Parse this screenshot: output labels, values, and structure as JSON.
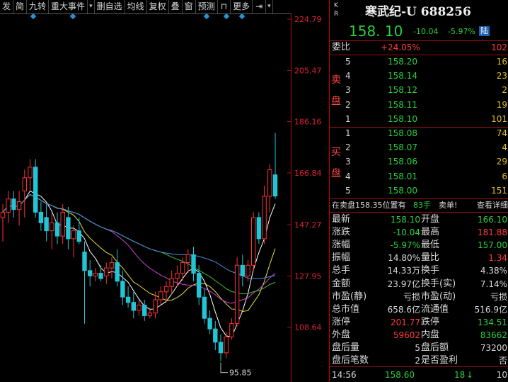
{
  "toolbar": {
    "items": [
      "发",
      "简",
      "九转",
      "重大事件",
      "▾",
      "删自选",
      "均线",
      "复权",
      "叠",
      "窗",
      "预测",
      "⊓",
      "更多",
      "⇥",
      "▾"
    ]
  },
  "chart": {
    "y_ticks": [
      "224.79",
      "205.47",
      "186.16",
      "166.84",
      "147.27",
      "127.95",
      "108.64"
    ],
    "low_label": "95.85",
    "colors": {
      "up": "#ff3333",
      "down": "#21c5d6",
      "ma5": "#ffffff",
      "ma10": "#e8e040",
      "ma20": "#d040d0",
      "ma60": "#40c040",
      "ma120": "#4a90e0"
    }
  },
  "chart_data": {
    "type": "candlestick",
    "ylim": [
      88,
      232
    ],
    "y_ticks": [
      224.79,
      205.47,
      186.16,
      166.84,
      147.27,
      127.95,
      108.64
    ],
    "low_annotation": 95.85,
    "candles": [
      {
        "o": 150,
        "h": 155,
        "l": 141,
        "c": 152
      },
      {
        "o": 152,
        "h": 160,
        "l": 148,
        "c": 157
      },
      {
        "o": 157,
        "h": 160,
        "l": 150,
        "c": 153
      },
      {
        "o": 153,
        "h": 160,
        "l": 147,
        "c": 156
      },
      {
        "o": 160,
        "h": 168,
        "l": 150,
        "c": 165
      },
      {
        "o": 165,
        "h": 172,
        "l": 160,
        "c": 169
      },
      {
        "o": 169,
        "h": 172,
        "l": 150,
        "c": 152
      },
      {
        "o": 152,
        "h": 156,
        "l": 145,
        "c": 148
      },
      {
        "o": 150,
        "h": 155,
        "l": 141,
        "c": 145
      },
      {
        "o": 145,
        "h": 152,
        "l": 138,
        "c": 148
      },
      {
        "o": 148,
        "h": 152,
        "l": 140,
        "c": 143
      },
      {
        "o": 143,
        "h": 155,
        "l": 140,
        "c": 152
      },
      {
        "o": 150,
        "h": 154,
        "l": 138,
        "c": 142
      },
      {
        "o": 142,
        "h": 147,
        "l": 135,
        "c": 145
      },
      {
        "o": 145,
        "h": 150,
        "l": 140,
        "c": 141
      },
      {
        "o": 137,
        "h": 141,
        "l": 110,
        "c": 130
      },
      {
        "o": 130,
        "h": 134,
        "l": 124,
        "c": 128
      },
      {
        "o": 128,
        "h": 131,
        "l": 126,
        "c": 129
      },
      {
        "o": 129,
        "h": 132,
        "l": 126,
        "c": 127
      },
      {
        "o": 128,
        "h": 133,
        "l": 125,
        "c": 131
      },
      {
        "o": 131,
        "h": 135,
        "l": 127,
        "c": 133
      },
      {
        "o": 133,
        "h": 138,
        "l": 124,
        "c": 126
      },
      {
        "o": 126,
        "h": 130,
        "l": 117,
        "c": 120
      },
      {
        "o": 120,
        "h": 124,
        "l": 116,
        "c": 118
      },
      {
        "o": 118,
        "h": 122,
        "l": 112,
        "c": 115
      },
      {
        "o": 115,
        "h": 119,
        "l": 113,
        "c": 117
      },
      {
        "o": 117,
        "h": 119,
        "l": 111,
        "c": 113
      },
      {
        "o": 113,
        "h": 116,
        "l": 112,
        "c": 114
      },
      {
        "o": 114,
        "h": 122,
        "l": 112,
        "c": 119
      },
      {
        "o": 119,
        "h": 124,
        "l": 117,
        "c": 122
      },
      {
        "o": 122,
        "h": 126,
        "l": 118,
        "c": 124
      },
      {
        "o": 124,
        "h": 130,
        "l": 121,
        "c": 127
      },
      {
        "o": 127,
        "h": 132,
        "l": 124,
        "c": 129
      },
      {
        "o": 129,
        "h": 135,
        "l": 126,
        "c": 133
      },
      {
        "o": 133,
        "h": 138,
        "l": 129,
        "c": 136
      },
      {
        "o": 136,
        "h": 139,
        "l": 126,
        "c": 129
      },
      {
        "o": 129,
        "h": 132,
        "l": 117,
        "c": 120
      },
      {
        "o": 120,
        "h": 123,
        "l": 110,
        "c": 112
      },
      {
        "o": 112,
        "h": 115,
        "l": 106,
        "c": 108
      },
      {
        "o": 108,
        "h": 111,
        "l": 100,
        "c": 103
      },
      {
        "o": 103,
        "h": 106,
        "l": 95.85,
        "c": 99
      },
      {
        "o": 99,
        "h": 107,
        "l": 97,
        "c": 105
      },
      {
        "o": 105,
        "h": 112,
        "l": 104,
        "c": 110
      },
      {
        "o": 110,
        "h": 135,
        "l": 109,
        "c": 132
      },
      {
        "o": 132,
        "h": 136,
        "l": 124,
        "c": 128
      },
      {
        "o": 128,
        "h": 134,
        "l": 126,
        "c": 132
      },
      {
        "o": 132,
        "h": 152,
        "l": 130,
        "c": 150
      },
      {
        "o": 150,
        "h": 152,
        "l": 140,
        "c": 142
      },
      {
        "o": 142,
        "h": 162,
        "l": 140,
        "c": 158
      },
      {
        "o": 158,
        "h": 170,
        "l": 152,
        "c": 168
      },
      {
        "o": 166.1,
        "h": 181.88,
        "l": 157,
        "c": 158.1
      }
    ]
  },
  "quote": {
    "kr": [
      "K",
      "R"
    ],
    "name": "寒武纪-U 688256",
    "price": "158. 10",
    "change": "-10.04",
    "change_pct": "-5.97%",
    "market": "陆",
    "weibi": {
      "label": "委比",
      "pct": "+24.05%",
      "diff": "102"
    },
    "sell_label": [
      "卖",
      "盘"
    ],
    "buy_label": [
      "买",
      "盘"
    ],
    "asks": [
      {
        "lv": "5",
        "price": "158.20",
        "vol": "16"
      },
      {
        "lv": "4",
        "price": "158.14",
        "vol": "23"
      },
      {
        "lv": "3",
        "price": "158.12",
        "vol": "2"
      },
      {
        "lv": "2",
        "price": "158.11",
        "vol": "19"
      },
      {
        "lv": "1",
        "price": "158.10",
        "vol": "101"
      }
    ],
    "bids": [
      {
        "lv": "1",
        "price": "158.08",
        "vol": "74"
      },
      {
        "lv": "2",
        "price": "158.07",
        "vol": "4"
      },
      {
        "lv": "3",
        "price": "158.06",
        "vol": "29"
      },
      {
        "lv": "4",
        "price": "158.01",
        "vol": "6"
      },
      {
        "lv": "5",
        "price": "158.00",
        "vol": "151"
      }
    ],
    "note": {
      "text": "在卖盘158.35位置有",
      "qty": "83手",
      "tag": "卖单!",
      "detail": "查看详细"
    },
    "stats": [
      {
        "l1": "最新",
        "v1": "158.10",
        "c1": "g",
        "l2": "开盘",
        "v2": "166.10",
        "c2": "g"
      },
      {
        "l1": "涨跌",
        "v1": "-10.04",
        "c1": "g",
        "l2": "最高",
        "v2": "181.88",
        "c2": "r"
      },
      {
        "l1": "涨幅",
        "v1": "-5.97%",
        "c1": "g",
        "l2": "最低",
        "v2": "157.00",
        "c2": "g"
      },
      {
        "l1": "振幅",
        "v1": "14.80%",
        "c1": "w",
        "l2": "量比",
        "v2": "1.34",
        "c2": "r"
      },
      {
        "l1": "总手",
        "v1": "14.33万",
        "c1": "w",
        "l2": "换手",
        "v2": "4.38%",
        "c2": "w"
      },
      {
        "l1": "金额",
        "v1": "23.97亿",
        "c1": "w",
        "l2": "换手(实)",
        "v2": "7.14%",
        "c2": "w"
      },
      {
        "l1": "市盈(静)",
        "v1": "亏损",
        "c1": "w",
        "l2": "市盈(动)",
        "v2": "亏损",
        "c2": "w"
      },
      {
        "l1": "总市值",
        "v1": "658.6亿",
        "c1": "w",
        "l2": "流通值",
        "v2": "516.9亿",
        "c2": "w"
      },
      {
        "l1": "涨停",
        "v1": "201.77",
        "c1": "r",
        "l2": "跌停",
        "v2": "134.51",
        "c2": "g"
      },
      {
        "l1": "外盘",
        "v1": "59602",
        "c1": "r",
        "l2": "内盘",
        "v2": "83662",
        "c2": "g"
      },
      {
        "l1": "盘后量",
        "v1": "5",
        "c1": "w",
        "l2": "盘后额",
        "v2": "73200",
        "c2": "w"
      },
      {
        "l1": "盘后笔数",
        "v1": "2",
        "c1": "w",
        "l2": "是否盈利",
        "v2": "否",
        "c2": "w"
      }
    ],
    "tick": {
      "time": "14:56",
      "price": "158.60",
      "vol": "18",
      "arrow": "↓",
      "count": "10"
    }
  }
}
